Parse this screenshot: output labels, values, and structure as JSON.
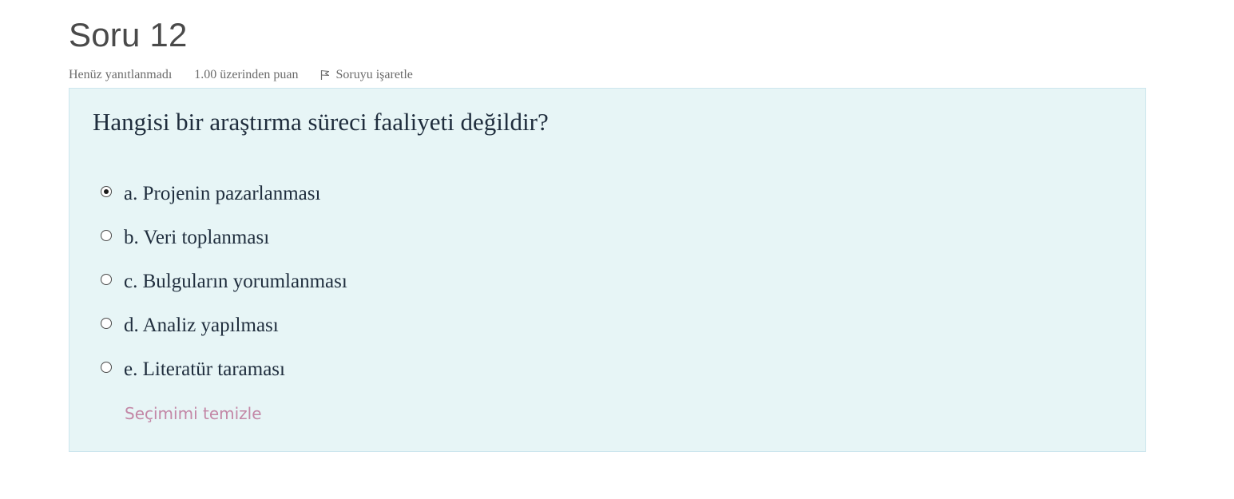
{
  "question": {
    "title": "Soru 12",
    "state": "Henüz yanıtlanmadı",
    "grade": "1.00 üzerinden puan",
    "flag_label": "Soruyu işaretle",
    "text": "Hangisi bir araştırma süreci faaliyeti değildir?",
    "answers": [
      {
        "label": "a. Projenin pazarlanması",
        "checked": true
      },
      {
        "label": "b. Veri toplanması",
        "checked": false
      },
      {
        "label": "c. Bulguların yorumlanması",
        "checked": false
      },
      {
        "label": "d. Analiz yapılması",
        "checked": false
      },
      {
        "label": "e. Literatür taraması",
        "checked": false
      }
    ],
    "clear_label": "Seçimimi temizle"
  },
  "colors": {
    "box_background": "#e7f5f6",
    "box_border": "#cde6ee",
    "clear_link": "#c387a6"
  },
  "icons": {
    "flag": "flag-icon"
  }
}
